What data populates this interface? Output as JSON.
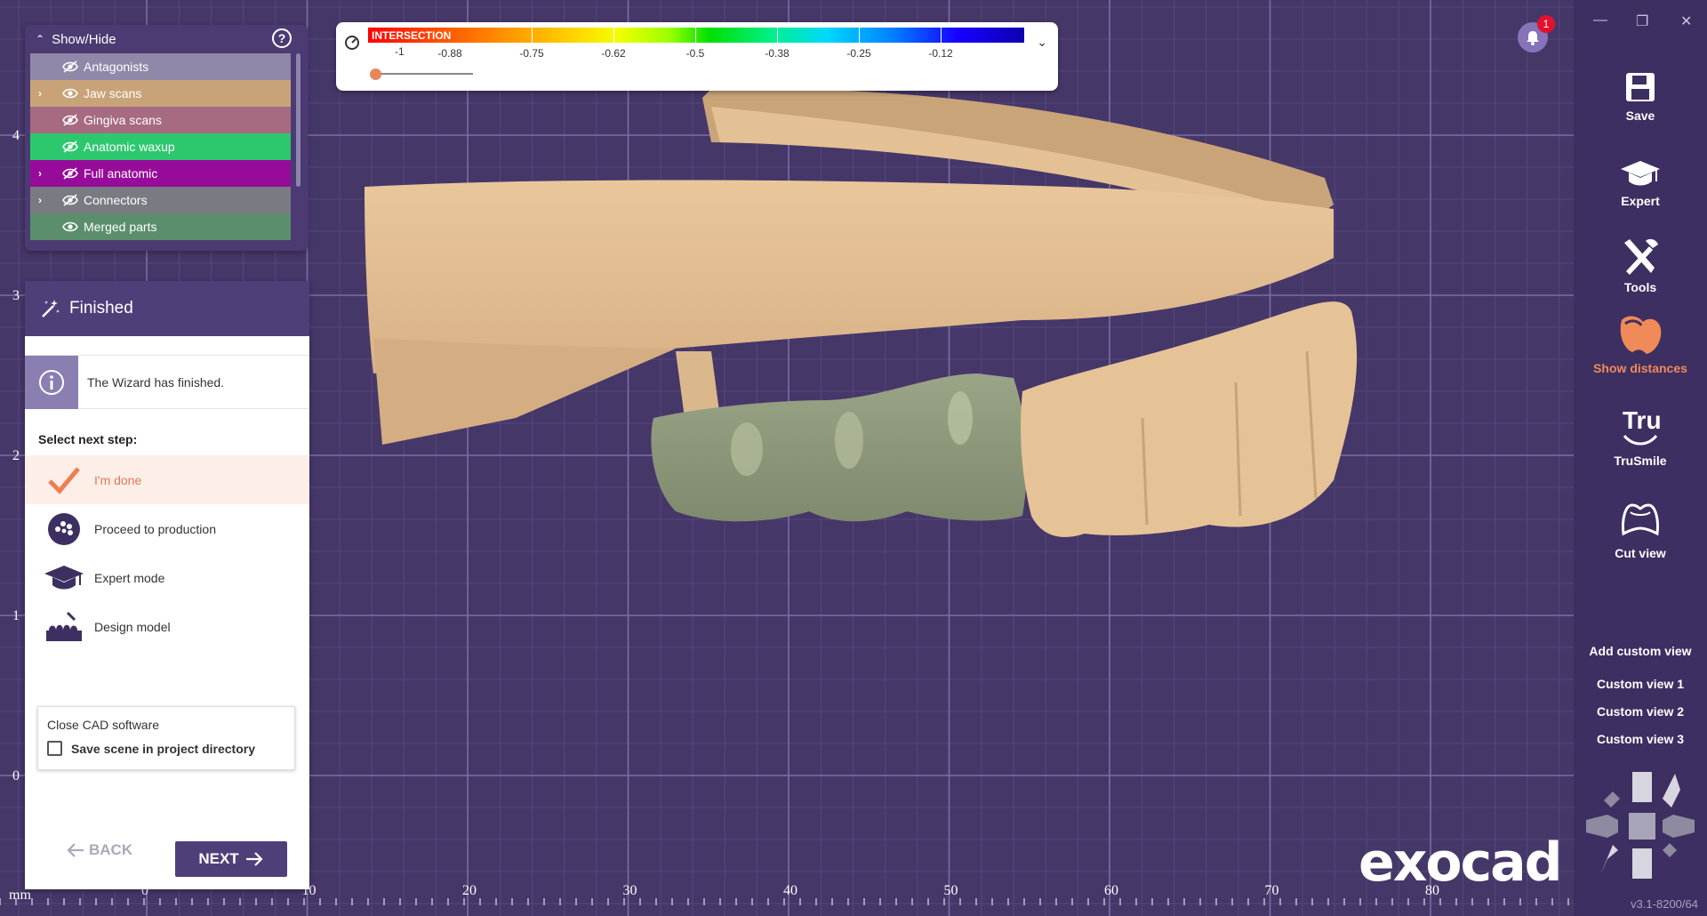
{
  "viewport": {
    "unit_label": "mm",
    "x_ticks": [
      "0",
      "10",
      "20",
      "30",
      "40",
      "50",
      "60",
      "70",
      "80"
    ],
    "y_ticks": [
      "4",
      "3",
      "2",
      "1",
      "0"
    ],
    "logo": "exocad"
  },
  "show_hide": {
    "title": "Show/Hide",
    "help": "?",
    "items": [
      {
        "label": "Antagonists",
        "color": "#8f88a8",
        "has_arrow": false,
        "eye": "eye-hidden-icon"
      },
      {
        "label": "Jaw scans",
        "color": "#c8a378",
        "has_arrow": true,
        "eye": "eye-icon"
      },
      {
        "label": "Gingiva scans",
        "color": "#a66a82",
        "has_arrow": false,
        "eye": "eye-hidden-icon"
      },
      {
        "label": "Anatomic waxup",
        "color": "#2dc86e",
        "has_arrow": false,
        "eye": "eye-hidden-icon"
      },
      {
        "label": "Full anatomic",
        "color": "#970b9b",
        "has_arrow": true,
        "eye": "eye-hidden-icon"
      },
      {
        "label": "Connectors",
        "color": "#7a7a82",
        "has_arrow": true,
        "eye": "eye-hidden-icon"
      },
      {
        "label": "Merged parts",
        "color": "#5a8e6c",
        "has_arrow": false,
        "eye": "eye-icon"
      }
    ]
  },
  "wizard": {
    "title": "Finished",
    "info_text": "The Wizard has finished.",
    "select_label": "Select next step:",
    "steps": [
      {
        "label": "I'm done",
        "icon": "checkmark-icon"
      },
      {
        "label": "Proceed to production",
        "icon": "production-icon"
      },
      {
        "label": "Expert mode",
        "icon": "graduation-cap-icon"
      },
      {
        "label": "Design model",
        "icon": "design-model-icon"
      }
    ],
    "close_title": "Close CAD software",
    "save_scene_label": "Save scene in project directory",
    "back_label": "BACK",
    "next_label": "NEXT"
  },
  "color_scale": {
    "title": "INTERSECTION",
    "min_label": "-1",
    "labels": [
      "-0.88",
      "-0.75",
      "-0.62",
      "-0.5",
      "-0.38",
      "-0.25",
      "-0.12"
    ]
  },
  "notifications": {
    "count": "1"
  },
  "sidebar": {
    "window_controls": [
      "—",
      "❐",
      "✕"
    ],
    "tools": [
      {
        "label": "Save",
        "icon": "save-icon"
      },
      {
        "label": "Expert",
        "icon": "graduation-cap-icon"
      },
      {
        "label": "Tools",
        "icon": "tools-icon"
      },
      {
        "label": "Show distances",
        "icon": "show-distances-icon"
      },
      {
        "label": "TruSmile",
        "icon": "trusmile-icon"
      },
      {
        "label": "Cut view",
        "icon": "cut-view-icon"
      }
    ],
    "add_custom_view": "Add custom view",
    "custom_views": [
      "Custom view 1",
      "Custom view 2",
      "Custom view 3"
    ],
    "version": "v3.1-8200/64"
  }
}
